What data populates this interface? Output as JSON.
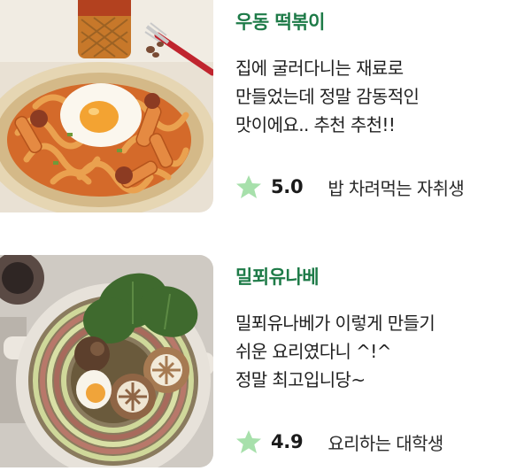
{
  "recipes": [
    {
      "title": "우동 떡볶이",
      "description_lines": [
        "집에 굴러다니는 재료로",
        "만들었는데 정말 감동적인",
        "맛이에요.. 추천 추천!!"
      ],
      "rating": "5.0",
      "author": "밥 차려먹는 자취생",
      "image_icon": "udon-tteokbokki-photo"
    },
    {
      "title": "밀푀유나베",
      "description_lines": [
        "밀푀유나베가 이렇게 만들기",
        "쉬운 요리였다니 ^!^",
        "정말 최고입니당~"
      ],
      "rating": "4.9",
      "author": "요리하는 대학생",
      "image_icon": "millefeuille-nabe-photo"
    }
  ],
  "colors": {
    "title": "#1e7b48",
    "star": "#a7e0ab",
    "text": "#1f1f1f"
  },
  "icons": {
    "rating": "star-icon"
  }
}
